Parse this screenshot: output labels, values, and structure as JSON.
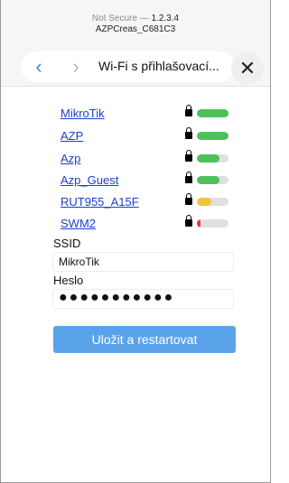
{
  "browser": {
    "security_label": "Not Secure —",
    "host": "1.2.3.4",
    "subtitle": "AZPCreas_C681C3",
    "tab_title": "Wi-Fi s přihlašovací...",
    "back_icon": "chevron-left-icon",
    "forward_icon": "chevron-right-icon",
    "close_icon": "close-icon"
  },
  "networks": [
    {
      "name": "MikroTik",
      "locked": true,
      "signal": 1.0,
      "color": "#4cc05a"
    },
    {
      "name": "AZP",
      "locked": true,
      "signal": 1.0,
      "color": "#4cc05a"
    },
    {
      "name": "Azp",
      "locked": true,
      "signal": 0.7,
      "color": "#4cc05a"
    },
    {
      "name": "Azp_Guest",
      "locked": true,
      "signal": 0.7,
      "color": "#4cc05a"
    },
    {
      "name": "RUT955_A15F",
      "locked": true,
      "signal": 0.45,
      "color": "#f3c23b"
    },
    {
      "name": "SWM2",
      "locked": true,
      "signal": 0.1,
      "color": "#e53935"
    }
  ],
  "form": {
    "ssid_label": "SSID",
    "ssid_value": "MikroTik",
    "password_label": "Heslo",
    "password_value": "●●●●●●●●●●●",
    "save_button": "Uložit a restartovat"
  }
}
